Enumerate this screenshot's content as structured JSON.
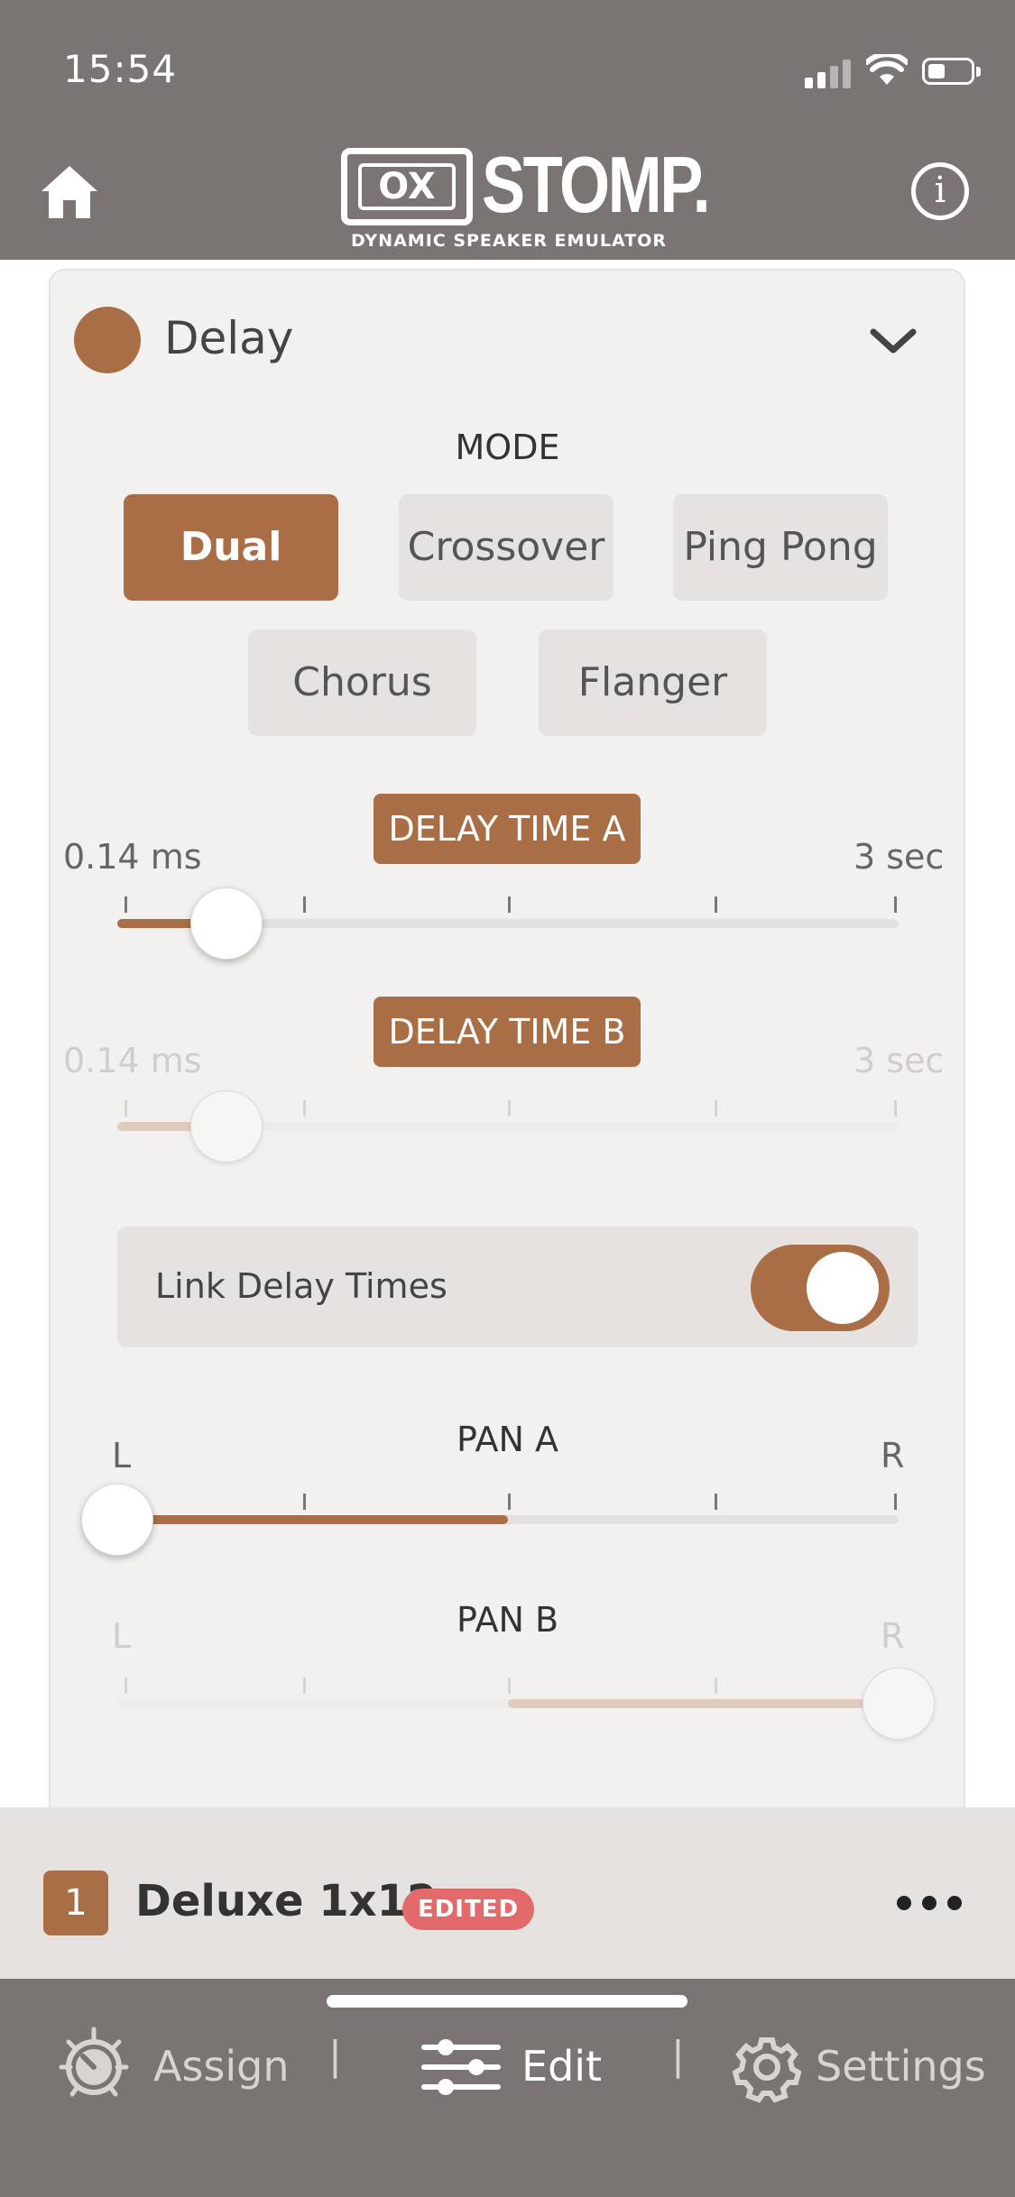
{
  "status_bar": {
    "time": "15:54"
  },
  "header": {
    "logo_box_text": "OX",
    "logo_word": "STOMP.",
    "logo_sub": "DYNAMIC SPEAKER EMULATOR",
    "info_glyph": "i"
  },
  "section": {
    "title": "Delay",
    "dot_color": "#aa6e46"
  },
  "mode": {
    "label": "MODE",
    "options": [
      "Dual",
      "Crossover",
      "Ping Pong",
      "Chorus",
      "Flanger"
    ],
    "selected": "Dual"
  },
  "delay_a": {
    "label": "DELAY TIME A",
    "min_label": "0.14 ms",
    "max_label": "3 sec",
    "position": 0.14
  },
  "delay_b": {
    "label": "DELAY TIME B",
    "min_label": "0.14 ms",
    "max_label": "3 sec",
    "position": 0.14,
    "enabled": false
  },
  "link": {
    "label": "Link Delay Times",
    "on": true
  },
  "pan_a": {
    "label": "PAN A",
    "left_label": "L",
    "right_label": "R",
    "position": 0.0
  },
  "pan_b": {
    "label": "PAN B",
    "left_label": "L",
    "right_label": "R",
    "position": 1.0,
    "enabled": false
  },
  "preset": {
    "number": "1",
    "name": "Deluxe 1x12",
    "badge": "EDITED"
  },
  "nav": {
    "items": [
      {
        "label": "Assign",
        "icon": "knob-icon"
      },
      {
        "label": "Edit",
        "icon": "sliders-icon"
      },
      {
        "label": "Settings",
        "icon": "gear-icon"
      }
    ],
    "separator": "|"
  },
  "colors": {
    "accent": "#aa6e46",
    "header": "#7a7572",
    "panel": "#f3f1f0",
    "button": "#e6e2df",
    "edited": "#e36a6a"
  }
}
